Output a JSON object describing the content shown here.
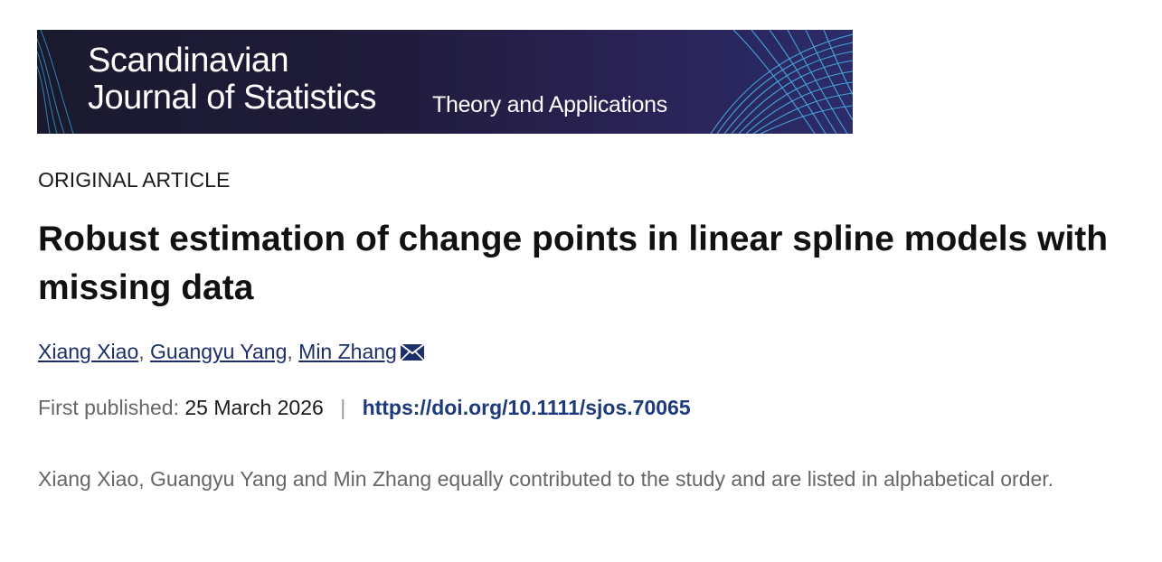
{
  "journal": {
    "name_line1": "Scandinavian",
    "name_line2": "Journal of Statistics",
    "tagline": "Theory and Applications"
  },
  "article": {
    "type": "ORIGINAL ARTICLE",
    "title": "Robust estimation of change points in linear spline models with missing data",
    "authors": [
      {
        "name": "Xiang Xiao"
      },
      {
        "name": "Guangyu Yang"
      },
      {
        "name": "Min Zhang",
        "corresponding": true
      }
    ],
    "author_separator": ",",
    "published_label": "First published:",
    "published_date": "25 March 2026",
    "pipe": "|",
    "doi": "https://doi.org/10.1111/sjos.70065",
    "contribution_note": "Xiang Xiao, Guangyu Yang and Min Zhang equally contributed to the study and are listed in alphabetical order."
  },
  "colors": {
    "banner_bg": "#1f1b3a",
    "banner_lines": "#3aa7e0",
    "link": "#1d2f6b",
    "doi": "#1d3b7a",
    "muted": "#666666"
  },
  "icons": {
    "corresponding_author": "envelope-icon"
  }
}
